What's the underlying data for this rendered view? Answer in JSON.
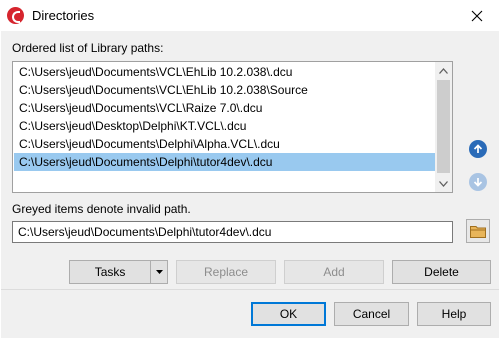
{
  "window": {
    "title": "Directories",
    "icon": "delphi-app-icon",
    "close_icon": "close-icon"
  },
  "library": {
    "list_label": "Ordered list of Library paths:",
    "items": [
      {
        "label": "C:\\Users\\jeud\\Documents\\VCL\\EhLib 10.2.038\\.dcu",
        "selected": false
      },
      {
        "label": "C:\\Users\\jeud\\Documents\\VCL\\EhLib 10.2.038\\Source",
        "selected": false
      },
      {
        "label": "C:\\Users\\jeud\\Documents\\VCL\\Raize 7.0\\.dcu",
        "selected": false
      },
      {
        "label": "C:\\Users\\jeud\\Desktop\\Delphi\\KT.VCL\\.dcu",
        "selected": false
      },
      {
        "label": "C:\\Users\\jeud\\Documents\\Delphi\\Alpha.VCL\\.dcu",
        "selected": false
      },
      {
        "label": "C:\\Users\\jeud\\Documents\\Delphi\\tutor4dev\\.dcu",
        "selected": true
      }
    ],
    "move_up_icon": "arrow-up-circle-icon",
    "move_down_icon": "arrow-down-circle-icon"
  },
  "path": {
    "hint": "Greyed items denote invalid path.",
    "value": "C:\\Users\\jeud\\Documents\\Delphi\\tutor4dev\\.dcu",
    "browse_icon": "folder-icon"
  },
  "actions": {
    "tasks": "Tasks",
    "replace": "Replace",
    "add": "Add",
    "delete": "Delete"
  },
  "footer": {
    "ok": "OK",
    "cancel": "Cancel",
    "help": "Help"
  },
  "colors": {
    "selection": "#99c9ef",
    "focus_border": "#0078d7",
    "brand": "#d6252e"
  }
}
